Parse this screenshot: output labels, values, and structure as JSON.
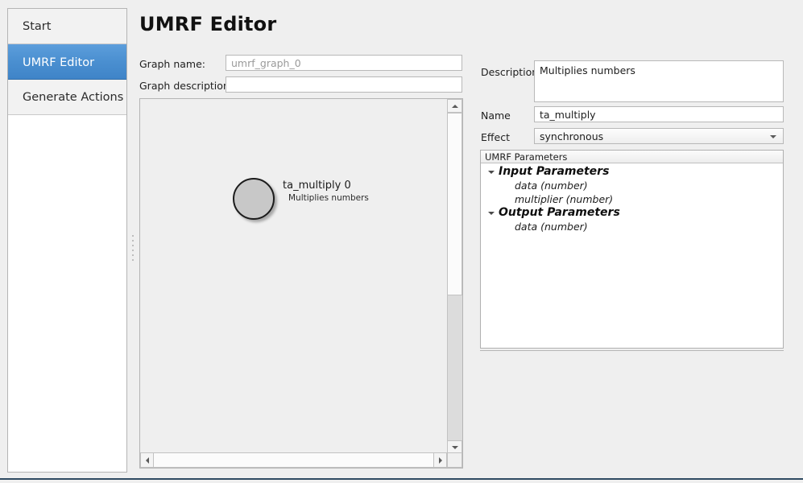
{
  "sidebar": {
    "items": [
      {
        "label": "Start",
        "selected": false
      },
      {
        "label": "UMRF Editor",
        "selected": true
      },
      {
        "label": "Generate Actions",
        "selected": false
      }
    ]
  },
  "header": {
    "title": "UMRF Editor"
  },
  "graph_form": {
    "name_label": "Graph name:",
    "name_value": "",
    "name_placeholder": "umrf_graph_0",
    "description_label": "Graph description:",
    "description_value": "",
    "description_placeholder": ""
  },
  "canvas": {
    "nodes": [
      {
        "title": "ta_multiply 0",
        "subtitle": "Multiplies numbers",
        "fill_color": "#c8c8c8",
        "border_color": "#1c1c1c"
      }
    ],
    "vertical_scrollbar": {
      "up_icon": "triangle-up-icon",
      "down_icon": "triangle-down-icon"
    },
    "horizontal_scrollbar": {
      "left_icon": "triangle-left-icon",
      "right_icon": "triangle-right-icon"
    }
  },
  "properties": {
    "description_label": "Description",
    "description_value": "Multiplies numbers",
    "name_label": "Name",
    "name_value": "ta_multiply",
    "effect_label": "Effect",
    "effect_value": "synchronous",
    "effect_dropdown_icon": "chevron-down-icon"
  },
  "parameters": {
    "header": "UMRF Parameters",
    "tree": [
      {
        "label": "Input Parameters",
        "type": "group",
        "expander": "triangle-down-icon",
        "children": [
          {
            "label": "data (number)",
            "type": "child"
          },
          {
            "label": "multiplier (number)",
            "type": "child"
          }
        ]
      },
      {
        "label": "Output Parameters",
        "type": "group",
        "expander": "triangle-down-icon",
        "children": [
          {
            "label": "data (number)",
            "type": "child"
          }
        ]
      }
    ]
  },
  "colors": {
    "accent": "#4a8fd0",
    "background": "#efefef",
    "bottom_rule": "#2f4a62"
  }
}
